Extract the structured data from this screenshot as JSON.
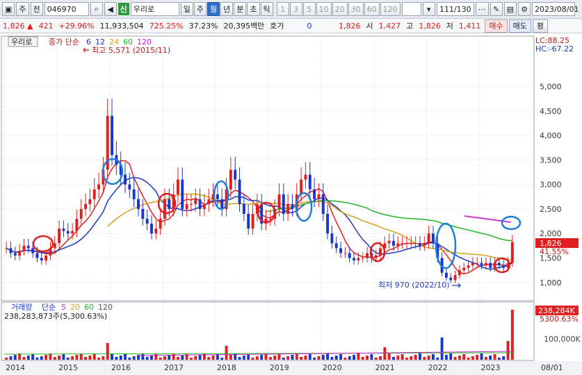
{
  "toolbar": {
    "period_toggle": "주",
    "prev_label": "전",
    "code": "046970",
    "new_badge": "신",
    "stock_name": "우리로",
    "periods": [
      "일",
      "주",
      "월",
      "년",
      "분",
      "초",
      "틱"
    ],
    "active_period": "월",
    "intervals": [
      "1",
      "3",
      "5",
      "10",
      "20",
      "30",
      "60",
      "120"
    ],
    "count": "111",
    "count_total": "/130",
    "date": "2023/08/01"
  },
  "quote": {
    "price": "1,826",
    "change": "421",
    "change_pct": "+29.96%",
    "volume": "11,933,504",
    "vol_ratio": "725.25%",
    "turnover": "37.23%",
    "amount": "20,395백만",
    "hoga_label": "호가",
    "hoga_value": "0",
    "hoga_price": "1,826",
    "open_label": "시",
    "open": "1,427",
    "high_label": "고",
    "high": "1,826",
    "low_label": "저",
    "low": "1,411",
    "buy_label": "매수",
    "sell_label": "매도",
    "eval_label": "평"
  },
  "price_panel": {
    "name_tab": "우리로",
    "legend_prefix": "종가 단순",
    "ma": [
      {
        "period": "6",
        "color": "#1a37c8"
      },
      {
        "period": "12",
        "color": "#1a37c8"
      },
      {
        "period": "24",
        "color": "#d4a21a"
      },
      {
        "period": "60",
        "color": "#22b822"
      },
      {
        "period": "120",
        "color": "#cc22cc"
      }
    ],
    "high_note": "최고 5,571 (2015/11)",
    "low_note": "최저 970 (2022/10)",
    "lc": "LC:88.25",
    "hc": "HC:-67.22",
    "current_price": "1,826",
    "current_pct": "41.55%"
  },
  "volume_panel": {
    "name": "거래량",
    "legend_prefix": "단순",
    "ma": [
      {
        "period": "5",
        "color": "#cc22cc"
      },
      {
        "period": "20",
        "color": "#d4a21a"
      },
      {
        "period": "60",
        "color": "#22b822"
      },
      {
        "period": "120",
        "color": "#555555"
      }
    ],
    "readout": "238,283,873주(5,300.63%)",
    "current_vol": "238,284K",
    "current_pct": "5300.63%",
    "axis_label": "100,000K"
  },
  "x_axis": {
    "years": [
      "2014",
      "2015",
      "2016",
      "2017",
      "2018",
      "2019",
      "2020",
      "2021",
      "2022",
      "2023"
    ],
    "end_label": "08/01"
  },
  "chart_data": {
    "type": "candlestick",
    "yticks": [
      1000,
      1500,
      2000,
      2500,
      3000,
      3500,
      4000,
      4500,
      5000
    ],
    "ylim": [
      700,
      5800
    ],
    "x_start": "2014/01",
    "x_end": "2023/08",
    "monthly_close_estimate": [
      1700,
      1600,
      1550,
      1650,
      1750,
      1700,
      1600,
      1500,
      1450,
      1550,
      1700,
      1800,
      2100,
      2050,
      2000,
      2050,
      2300,
      2500,
      2600,
      2700,
      2900,
      3000,
      3300,
      4400,
      3600,
      3400,
      3200,
      3000,
      2900,
      2700,
      2500,
      2300,
      2200,
      2000,
      2100,
      2300,
      2700,
      2500,
      2800,
      3100,
      2500,
      2600,
      2600,
      2700,
      2500,
      2600,
      2700,
      2800,
      2700,
      2500,
      2900,
      3300,
      3100,
      2600,
      2400,
      2100,
      2400,
      2600,
      2200,
      2300,
      2300,
      2500,
      2800,
      2400,
      2600,
      2500,
      2800,
      3100,
      3200,
      2900,
      2700,
      2800,
      2400,
      2000,
      1800,
      1700,
      1600,
      1600,
      1500,
      1450,
      1500,
      1500,
      1600,
      1500,
      1550,
      1700,
      1800,
      1850,
      1750,
      1800,
      1800,
      1800,
      1800,
      1800,
      1750,
      1800,
      2000,
      1800,
      1500,
      1200,
      1100,
      1050,
      1150,
      1250,
      1300,
      1350,
      1400,
      1400,
      1350,
      1400,
      1300,
      1400,
      1350,
      1300,
      1400,
      1826
    ],
    "volume_highlights": {
      "2022-04": 32000000.0,
      "2023-07": 70000000.0,
      "2023-08": 238000000.0
    }
  }
}
